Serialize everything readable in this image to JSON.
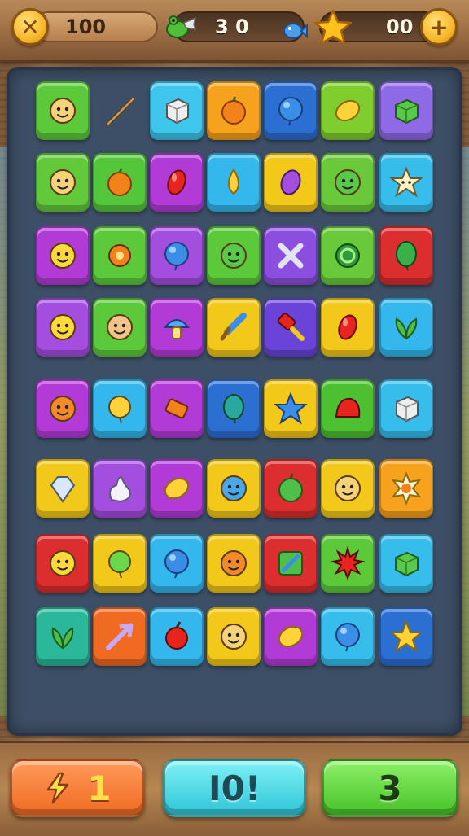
{
  "hud": {
    "score": "100",
    "moves": "3  0",
    "stars": "00",
    "left_button_glyph": "✕",
    "right_button_glyph": "+"
  },
  "grid": {
    "rows": [
      [
        {
          "color": "#5cc93a",
          "icon": "smiley-face"
        },
        {
          "color": "none",
          "icon": "wand"
        },
        {
          "color": "#3ec6ec",
          "icon": "cube"
        },
        {
          "color": "#f7a21c",
          "icon": "orange-fruit"
        },
        {
          "color": "#2c6fd2",
          "icon": "blue-ball"
        },
        {
          "color": "#7fce2e",
          "icon": "lemon"
        },
        {
          "color": "#8f6ae6",
          "icon": "green-box"
        }
      ],
      [
        {
          "color": "#62c93a",
          "icon": "smiley-face"
        },
        {
          "color": "#54c63a",
          "icon": "orange-ball"
        },
        {
          "color": "#b23bd8",
          "icon": "red-gem"
        },
        {
          "color": "#33b7ec",
          "icon": "yellow-drop"
        },
        {
          "color": "#f2c81a",
          "icon": "purple-gem"
        },
        {
          "color": "#6ac93a",
          "icon": "green-face"
        },
        {
          "color": "#36bdec",
          "icon": "star-face"
        }
      ],
      [
        {
          "color": "#b23bd8",
          "icon": "yellow-creature"
        },
        {
          "color": "#5cc93a",
          "icon": "orange-target"
        },
        {
          "color": "#a44ee0",
          "icon": "blue-orb"
        },
        {
          "color": "#5cc93a",
          "icon": "green-face"
        },
        {
          "color": "#8c4ee0",
          "icon": "x-mark"
        },
        {
          "color": "#6ac93a",
          "icon": "green-ring"
        },
        {
          "color": "#dc2e2e",
          "icon": "green-leaf"
        }
      ],
      [
        {
          "color": "#a44ee0",
          "icon": "yellow-creature"
        },
        {
          "color": "#5cc93a",
          "icon": "face-creature"
        },
        {
          "color": "#b23bd8",
          "icon": "mushroom"
        },
        {
          "color": "#f2c81a",
          "icon": "sword"
        },
        {
          "color": "#6a44d8",
          "icon": "red-key"
        },
        {
          "color": "#f2c81a",
          "icon": "red-gem"
        },
        {
          "color": "#33b7ec",
          "icon": "leaf"
        }
      ],
      [
        {
          "color": "#b23bd8",
          "icon": "orange-creature"
        },
        {
          "color": "#33b7ec",
          "icon": "yellow-balloon"
        },
        {
          "color": "#b23bd8",
          "icon": "orange-bar"
        },
        {
          "color": "#2c6fd2",
          "icon": "teal-leaf"
        },
        {
          "color": "#f2c81a",
          "icon": "blue-star"
        },
        {
          "color": "#4cc030",
          "icon": "red-jelly"
        },
        {
          "color": "#36bdec",
          "icon": "cube"
        }
      ],
      [
        {
          "color": "#f2c81a",
          "icon": "diamond"
        },
        {
          "color": "#a44ee0",
          "icon": "white-bag"
        },
        {
          "color": "#b23bd8",
          "icon": "yellow-lemon"
        },
        {
          "color": "#f2c81a",
          "icon": "blue-creature"
        },
        {
          "color": "#dc2e2e",
          "icon": "green-apple"
        },
        {
          "color": "#f2c81a",
          "icon": "smiley-face"
        },
        {
          "color": "#f7a21c",
          "icon": "sun-gem"
        }
      ],
      [
        {
          "color": "#dc2e2e",
          "icon": "yellow-creature"
        },
        {
          "color": "#f2c81a",
          "icon": "green-balloon"
        },
        {
          "color": "#33b7ec",
          "icon": "blue-balloon"
        },
        {
          "color": "#f2c81a",
          "icon": "orange-face"
        },
        {
          "color": "#dc2e2e",
          "icon": "green-card"
        },
        {
          "color": "#5cc93a",
          "icon": "red-burst"
        },
        {
          "color": "#36bdec",
          "icon": "green-box"
        }
      ],
      [
        {
          "color": "#2bb89a",
          "icon": "leaf"
        },
        {
          "color": "#f06a22",
          "icon": "arrow"
        },
        {
          "color": "#33b7ec",
          "icon": "red-bomb"
        },
        {
          "color": "#f2c81a",
          "icon": "smiley-face"
        },
        {
          "color": "#b23bd8",
          "icon": "yellow-lemon"
        },
        {
          "color": "#36bdec",
          "icon": "blue-ball"
        },
        {
          "color": "#2c6fd2",
          "icon": "yellow-star"
        }
      ]
    ]
  },
  "bottom": {
    "left_label": "1",
    "left_icon": "lightning-icon",
    "center_label": "I0!",
    "right_label": "3"
  }
}
